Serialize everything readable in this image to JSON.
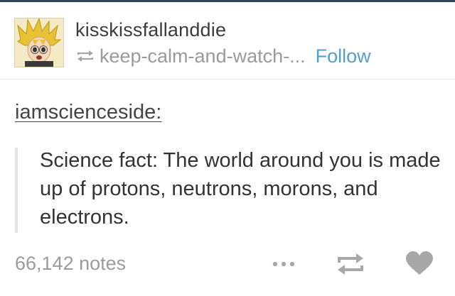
{
  "post": {
    "username": "kisskissfallanddie",
    "reblogged_from": "keep-calm-and-watch-...",
    "follow_label": "Follow",
    "source_label": "iamscienceside:",
    "quote_text": "Science fact: The world around you is made up of protons, neutrons, morons, and electrons.",
    "notes": "66,142 notes"
  },
  "icons": {
    "reblog_small": "reblog-icon",
    "more": "more-dots-icon",
    "reblog": "reblog-icon",
    "like": "heart-icon"
  },
  "colors": {
    "follow_link": "#529ecc",
    "muted_text": "#9b9b9b",
    "icon_gray": "#a8a8a8",
    "top_rule": "#34465d"
  }
}
